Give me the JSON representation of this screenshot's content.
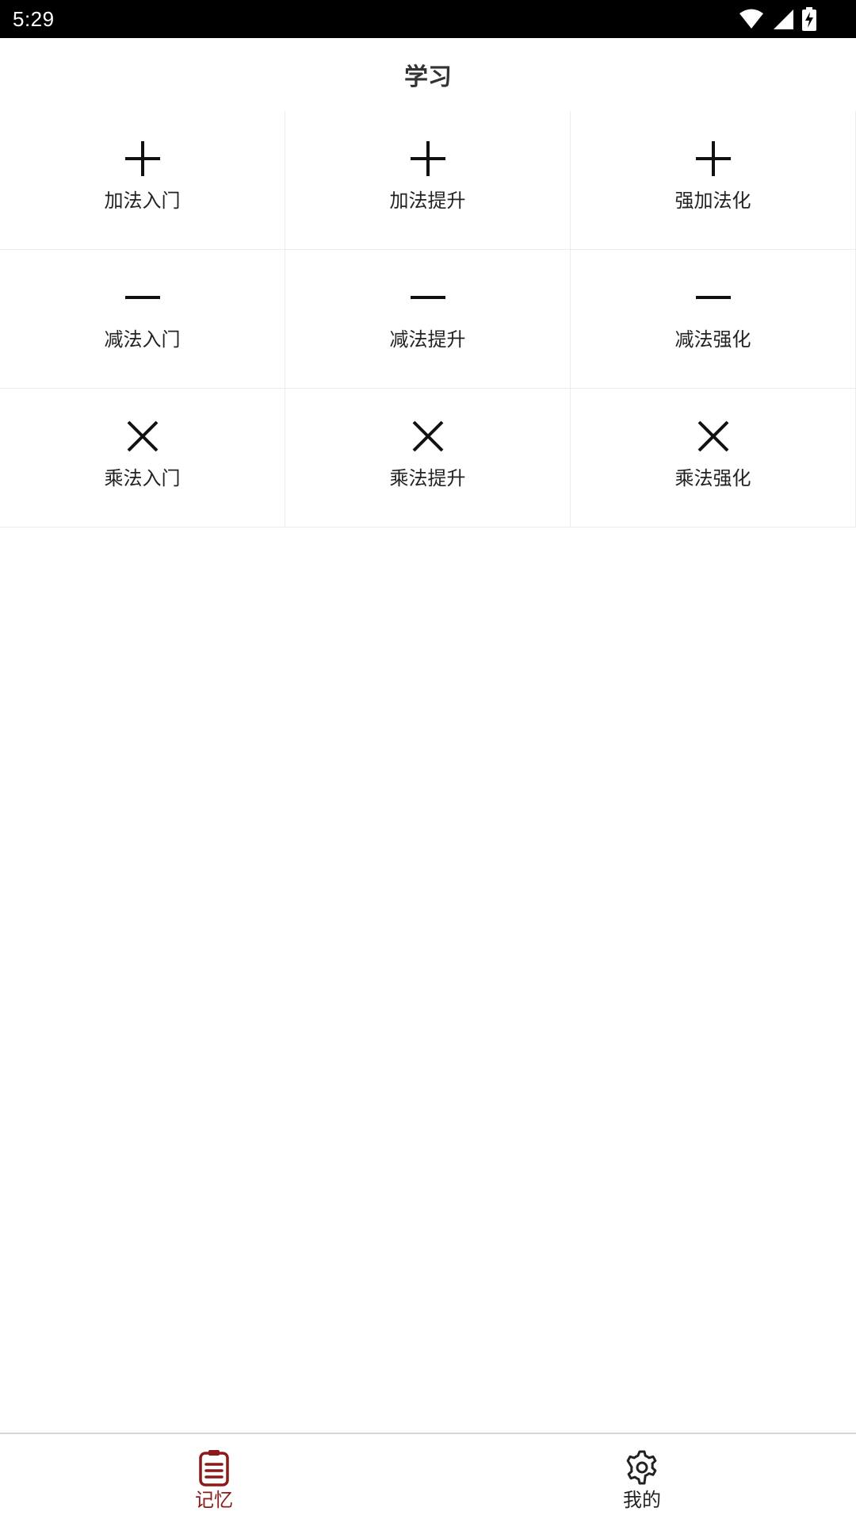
{
  "status_bar": {
    "time": "5:29",
    "icons": [
      "wifi-icon",
      "signal-icon",
      "battery-charging-icon"
    ]
  },
  "header": {
    "title": "学习"
  },
  "grid": {
    "items": [
      {
        "icon": "plus-icon",
        "label": "加法入门"
      },
      {
        "icon": "plus-icon",
        "label": "加法提升"
      },
      {
        "icon": "plus-icon",
        "label": "强加法化"
      },
      {
        "icon": "minus-icon",
        "label": "减法入门"
      },
      {
        "icon": "minus-icon",
        "label": "减法提升"
      },
      {
        "icon": "minus-icon",
        "label": "减法强化"
      },
      {
        "icon": "multiply-icon",
        "label": "乘法入门"
      },
      {
        "icon": "multiply-icon",
        "label": "乘法提升"
      },
      {
        "icon": "multiply-icon",
        "label": "乘法强化"
      }
    ]
  },
  "bottom_nav": {
    "items": [
      {
        "icon": "clipboard-icon",
        "label": "记忆",
        "active": true
      },
      {
        "icon": "gear-icon",
        "label": "我的",
        "active": false
      }
    ]
  },
  "colors": {
    "accent": "#8b1a1a",
    "text": "#222222",
    "divider": "#ececec"
  }
}
